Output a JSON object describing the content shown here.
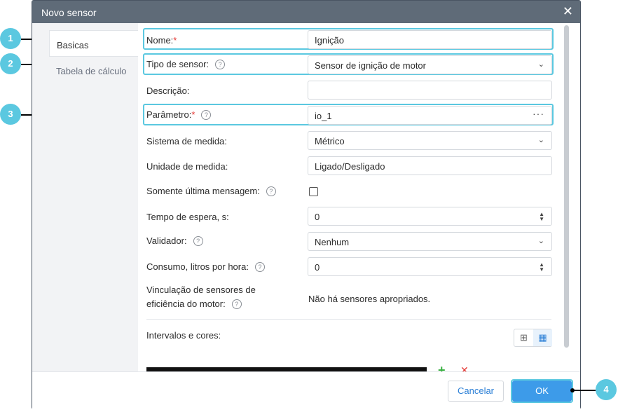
{
  "dialog": {
    "title": "Novo sensor",
    "close_glyph": "✕"
  },
  "sidebar": {
    "tabs": [
      {
        "label": "Basicas",
        "active": true
      },
      {
        "label": "Tabela de cálculo",
        "active": false
      }
    ]
  },
  "form": {
    "name": {
      "label": "Nome:",
      "required_mark": "*",
      "value": "Ignição"
    },
    "sensor_type": {
      "label": "Tipo de sensor:",
      "value": "Sensor de ignição de motor"
    },
    "description": {
      "label": "Descrição:",
      "value": ""
    },
    "parameter": {
      "label": "Parâmetro:",
      "required_mark": "*",
      "value": "io_1",
      "more_glyph": "···"
    },
    "measurement_system": {
      "label": "Sistema de medida:",
      "value": "Métrico"
    },
    "unit": {
      "label": "Unidade de medida:",
      "value": "Ligado/Desligado"
    },
    "last_message_only": {
      "label": "Somente última mensagem:",
      "checked": false
    },
    "timeout": {
      "label": "Tempo de espera, s:",
      "value": "0"
    },
    "validator": {
      "label": "Validador:",
      "value": "Nenhum"
    },
    "consumption": {
      "label": "Consumo, litros por hora:",
      "value": "0"
    },
    "engine_efficiency": {
      "label_line1": "Vinculação de sensores de",
      "label_line2": "eficiência do motor:",
      "value": "Não há sensores apropriados."
    },
    "intervals": {
      "label": "Intervalos e cores:"
    }
  },
  "icons": {
    "help": "?",
    "chevron": "⌄",
    "spinner": "▲▼",
    "plus": "+",
    "remove": "✕",
    "grid_view": "⊞",
    "table_view": "▦"
  },
  "footer": {
    "cancel_label": "Cancelar",
    "ok_label": "OK"
  },
  "callouts": [
    "1",
    "2",
    "3",
    "4"
  ],
  "colors": {
    "titlebar": "#5f6b78",
    "highlight": "#5bc8e0",
    "accent": "#3d9be9",
    "required": "#e53935",
    "add": "#3bb143"
  }
}
